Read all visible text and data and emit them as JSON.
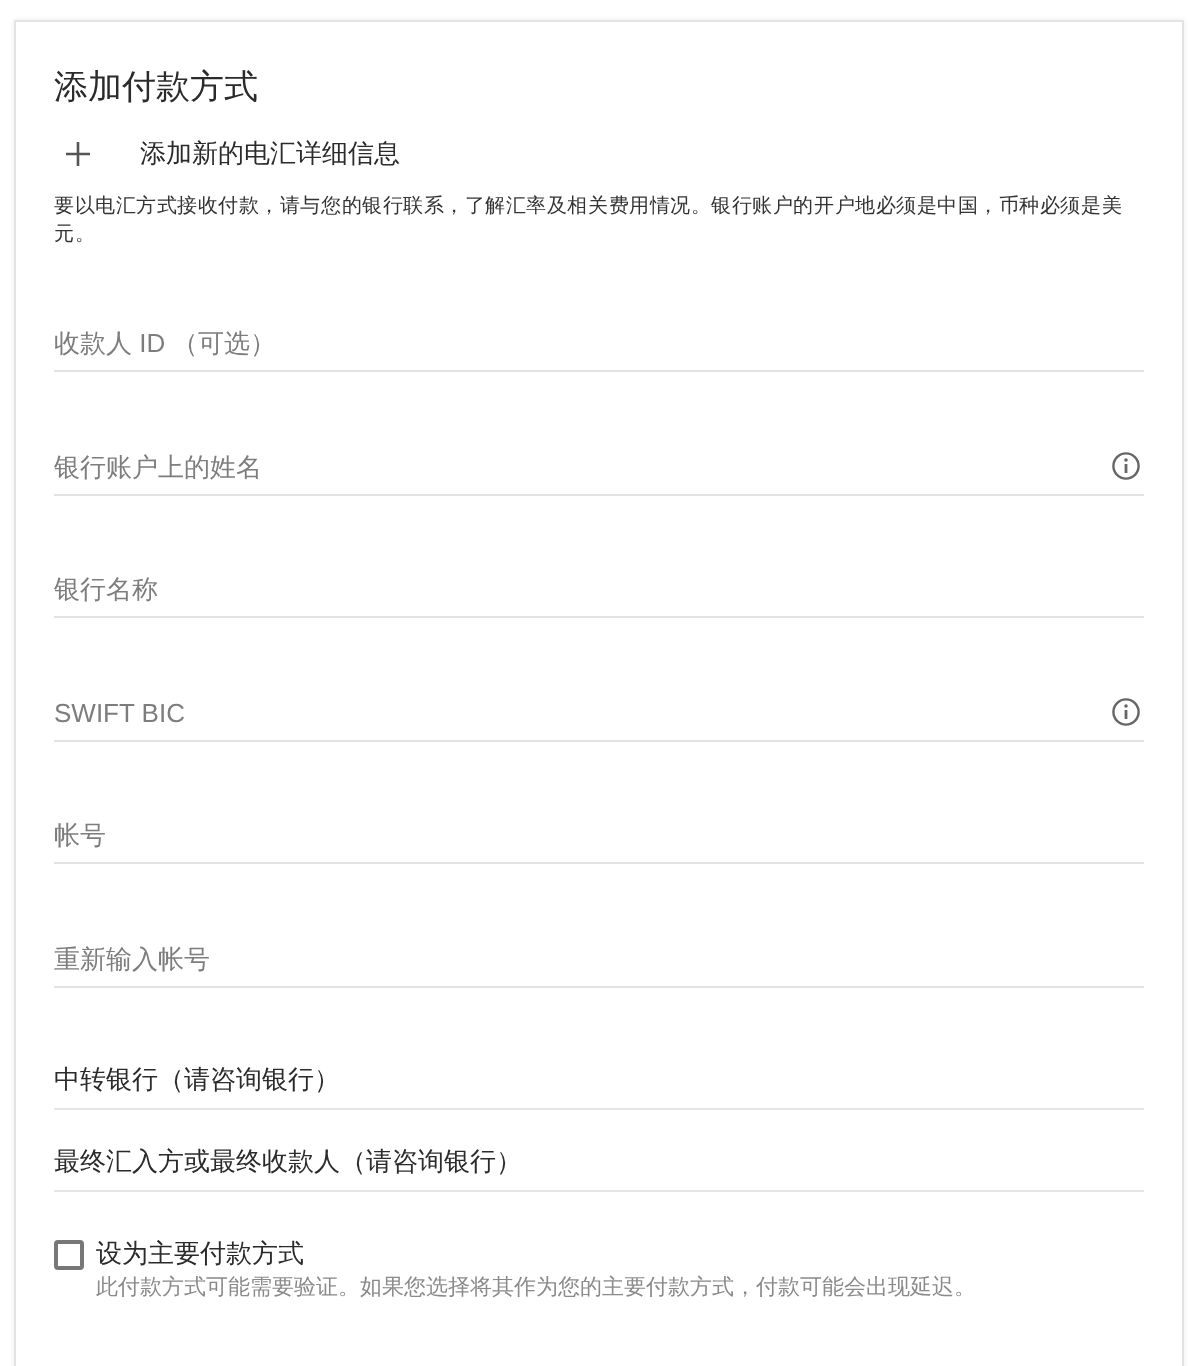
{
  "title": "添加付款方式",
  "add_action": {
    "label": "添加新的电汇详细信息"
  },
  "notice": "要以电汇方式接收付款，请与您的银行联系，了解汇率及相关费用情况。银行账户的开户地必须是中国，币种必须是美元。",
  "fields": [
    {
      "placeholder": "收款人 ID （可选）",
      "info": false
    },
    {
      "placeholder": "银行账户上的姓名",
      "info": true
    },
    {
      "placeholder": "银行名称",
      "info": false
    },
    {
      "placeholder": "SWIFT BIC",
      "info": true
    },
    {
      "placeholder": "帐号",
      "info": false
    },
    {
      "placeholder": "重新输入帐号",
      "info": false
    }
  ],
  "sections": [
    {
      "label": "中转银行（请咨询银行）"
    },
    {
      "label": "最终汇入方或最终收款人（请咨询银行）"
    }
  ],
  "primary_option": {
    "label": "设为主要付款方式",
    "checked": false,
    "note": "此付款方式可能需要验证。如果您选择将其作为您的主要付款方式，付款可能会出现延迟。"
  }
}
